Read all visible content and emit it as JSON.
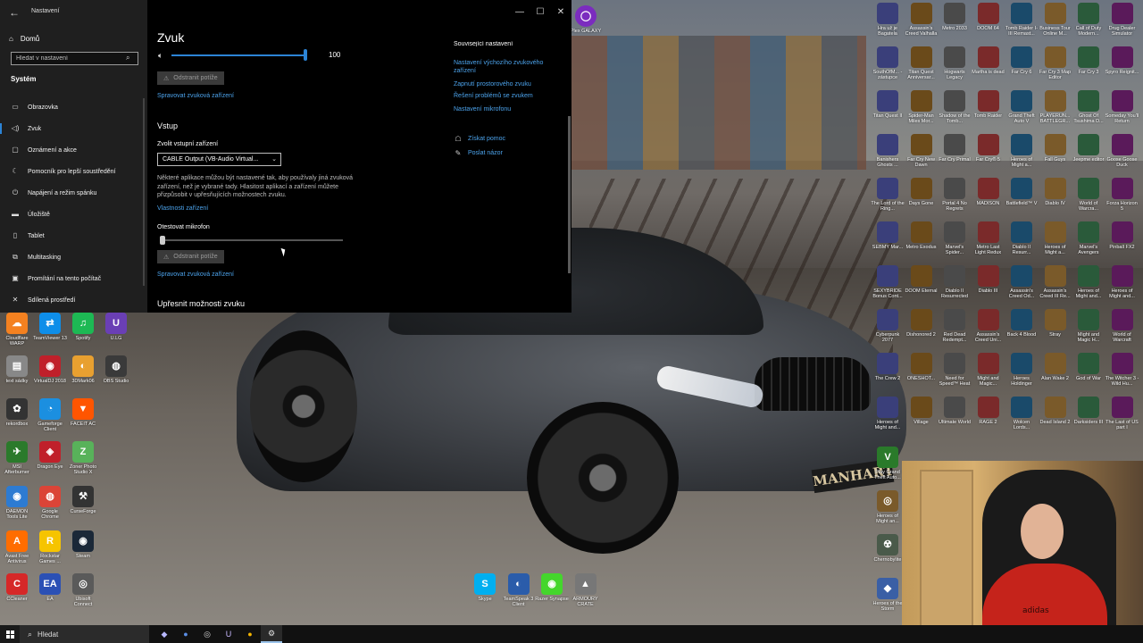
{
  "window": {
    "title": "Nastavení",
    "controls": [
      "—",
      "☐",
      "✕"
    ]
  },
  "sidebar": {
    "home": "Domů",
    "search_placeholder": "Hledat v nastavení",
    "section": "Systém",
    "items": [
      {
        "label": "Obrazovka",
        "icon": "monitor-icon",
        "glyph": "▭"
      },
      {
        "label": "Zvuk",
        "icon": "speaker-icon",
        "glyph": "◁)"
      },
      {
        "label": "Oznámení a akce",
        "icon": "notification-icon",
        "glyph": "▢"
      },
      {
        "label": "Pomocník pro lepší soustředění",
        "icon": "moon-icon",
        "glyph": "☾"
      },
      {
        "label": "Napájení a režim spánku",
        "icon": "power-icon",
        "glyph": "⏻"
      },
      {
        "label": "Úložiště",
        "icon": "storage-icon",
        "glyph": "▬"
      },
      {
        "label": "Tablet",
        "icon": "tablet-icon",
        "glyph": "▯"
      },
      {
        "label": "Multitasking",
        "icon": "multitask-icon",
        "glyph": "⧉"
      },
      {
        "label": "Promítání na tento počítač",
        "icon": "projection-icon",
        "glyph": "▣"
      },
      {
        "label": "Sdílená prostředí",
        "icon": "shared-icon",
        "glyph": "✕"
      }
    ],
    "active_index": 1
  },
  "main": {
    "title": "Zvuk",
    "volume": {
      "value": "100",
      "level": 1.0
    },
    "troubleshoot": "Odstranit potíže",
    "manage_devices": "Spravovat zvuková zařízení",
    "input_heading": "Vstup",
    "input_device_label": "Zvolit vstupní zařízení",
    "input_device_value": "CABLE Output (VB-Audio Virtual...",
    "input_note": "Některé aplikace můžou být nastavené tak, aby používaly jiná zvuková zařízení, než je vybrané tady. Hlasitost aplikací a zařízení můžete přizpůsobit v upřesňujících možnostech zvuku.",
    "device_props": "Vlastnosti zařízení",
    "mic_test_label": "Otestovat mikrofon",
    "mic_level": 0.0,
    "troubleshoot2": "Odstranit potíže",
    "manage_devices2": "Spravovat zvuková zařízení",
    "advanced_heading": "Upřesnit možnosti zvuku"
  },
  "related": {
    "heading_cut": "Související nastavení",
    "links": [
      "Nastavení výchozího zvukového zařízení",
      "Zapnutí prostorového zvuku",
      "Řešení problémů se zvukem",
      "Nastavení mikrofonu"
    ],
    "help": "Získat pomoc",
    "feedback": "Poslat názor"
  },
  "taskbar": {
    "search_placeholder": "Hledat",
    "apps": [
      {
        "name": "taskbar-app-1",
        "glyph": "◆",
        "color": "#b9b9ff"
      },
      {
        "name": "taskbar-app-2",
        "glyph": "●",
        "color": "#5b8ee6"
      },
      {
        "name": "taskbar-app-3",
        "glyph": "◎",
        "color": "#d8d8d8"
      },
      {
        "name": "taskbar-app-4",
        "glyph": "U",
        "color": "#c9b9ff"
      },
      {
        "name": "taskbar-app-5",
        "glyph": "●",
        "color": "#f4b400"
      },
      {
        "name": "taskbar-app-settings",
        "glyph": "⚙",
        "color": "#e0e0e0"
      }
    ]
  },
  "desktop_left": [
    {
      "label": "Cloudflare WARP",
      "color": "#f48120",
      "g": "☁"
    },
    {
      "label": "TeamViewer 13",
      "color": "#0e8ee9",
      "g": "⇄"
    },
    {
      "label": "Spotify",
      "color": "#1db954",
      "g": "♫"
    },
    {
      "label": "U.LG",
      "color": "#6a3fb5",
      "g": "U"
    },
    {
      "label": "text sádky",
      "color": "#888",
      "g": "▤"
    },
    {
      "label": "VirtualDJ 2018",
      "color": "#c0202a",
      "g": "◉"
    },
    {
      "label": "3DMark06",
      "color": "#e8a030",
      "g": "◐"
    },
    {
      "label": "OBS Studio",
      "color": "#3a3a3a",
      "g": "◍"
    },
    {
      "label": "rekordbox",
      "color": "#333",
      "g": "✿"
    },
    {
      "label": "Gameforge Client",
      "color": "#1b8fe0",
      "g": "◔"
    },
    {
      "label": "FACEIT AC",
      "color": "#ff5500",
      "g": "▼"
    },
    {
      "label": "MSI Afterburner",
      "color": "#2b7a2b",
      "g": "✈"
    },
    {
      "label": "Dragon Eye",
      "color": "#c0202a",
      "g": "◈"
    },
    {
      "label": "Zoner Photo Studio X",
      "color": "#58b25a",
      "g": "Z"
    },
    {
      "label": "DAEMON Tools Lite",
      "color": "#2d7bd2",
      "g": "◉"
    },
    {
      "label": "Google Chrome",
      "color": "#db4437",
      "g": "◍"
    },
    {
      "label": "CurseForge",
      "color": "#333",
      "g": "⚒"
    },
    {
      "label": "Avast Free Antivirus",
      "color": "#ff6d00",
      "g": "A"
    },
    {
      "label": "Rockstar Games ...",
      "color": "#f6c400",
      "g": "R"
    },
    {
      "label": "Steam",
      "color": "#1b2838",
      "g": "◉"
    },
    {
      "label": "CCleaner",
      "color": "#d62828",
      "g": "C"
    },
    {
      "label": "EA",
      "color": "#2b50b5",
      "g": "EA"
    },
    {
      "label": "Ubisoft Connect",
      "color": "#5a5a5a",
      "g": "◎"
    }
  ],
  "desktop_bottom": [
    {
      "label": "Skype",
      "color": "#00aff0",
      "g": "S"
    },
    {
      "label": "TeamSpeak 3 Client",
      "color": "#2a5caa",
      "g": "◐"
    },
    {
      "label": "Razer Synapse",
      "color": "#44d62c",
      "g": "◉"
    },
    {
      "label": "ARMOURY CRATE",
      "color": "#777",
      "g": "▲"
    }
  ],
  "desktop_right": [
    "Hra už je Bagatela",
    "Assassin's Creed Valhalla",
    "Metro 2033",
    "DOOM 64",
    "Tomb Raider I-III Remast...",
    "Business Tour Online M...",
    "Call of Duty Modern...",
    "Drug Dealer Simulator",
    "SouthOfM... - zástupce",
    "Titan Quest Anniversar...",
    "Hogwarts Legacy",
    "Martha is dead",
    "Far Cry 6",
    "Far Cry 3 Map Editor",
    "Far Cry 3",
    "Spyro Reignit...",
    "Titan Quest II",
    "Spider-Man Miles Mor...",
    "Shadow of the Tomb...",
    "Tomb Raider",
    "Grand Theft Auto V",
    "PLAYERUN... BATTLEGR...",
    "Ghost Of Tsushima D...",
    "Someday You'll Return",
    "Banishers Ghosts ...",
    "Far Cry New Dawn",
    "Far Cry Primal",
    "Far Cry® 5",
    "Heroes of Might a...",
    "Fall Guys",
    "Jeepme editor",
    "Goose Goose Duck",
    "The Lord of the Ring...",
    "Days Gone",
    "Portal 4 No Regrets",
    "MADISON",
    "Battlefield™ V",
    "Diablo IV",
    "World of Warcra...",
    "Forza Horizon 5",
    "SEBMY Mar...",
    "Metro Exodus",
    "Marvel's Spider...",
    "Metro Last Light Redux",
    "Diablo II Resurr...",
    "Heroes of Might a...",
    "Marvel's Avengers",
    "Pinball FX2",
    "SEXYBRIDE Bonus Cont...",
    "DOOM Eternal",
    "Diablo II Resurrected",
    "Diablo III",
    "Assassin's Creed Od...",
    "Assassin's Creed III Re...",
    "Heroes of Might and...",
    "Heroes of Might and...",
    "Cyberpunk 2077",
    "Dishonored 2",
    "Red Dead Redempt...",
    "Assassin's Creed Uni...",
    "Back 4 Blood",
    "Stray",
    "Might and Magic H...",
    "World of Warcraft",
    "The Crew 2",
    "ONESHOT...",
    "Need for Speed™ Heat",
    "Might and Magic...",
    "Heroes Holdinger",
    "Alan Wake 2",
    "God of War",
    "The Witcher 3 - Wild Hu...",
    "Heroes of Might and...",
    "Village",
    "Ultimate World",
    "RAGE 2",
    "Wolcen Lords...",
    "Dead Island 2",
    "Darksiders III",
    "The Last of US part I"
  ],
  "desktop_right_extra": [
    {
      "label": "Play Grand Theft Auto...",
      "color": "#2a7a2a",
      "g": "V"
    },
    {
      "label": "Heroes of Might an...",
      "color": "#7a5a2a",
      "g": "◎"
    },
    {
      "label": "Chernobylite",
      "color": "#4a5a4a",
      "g": "☢"
    },
    {
      "label": "Heroes of the Storm",
      "color": "#3a5fa5",
      "g": "◆"
    }
  ],
  "top_icon": {
    "label": "Plex GALAXY",
    "color": "#7b2cbf",
    "g": "◯"
  },
  "webcam": {
    "shirt_text": "adidas"
  },
  "car": {
    "plate": "MANHART"
  }
}
